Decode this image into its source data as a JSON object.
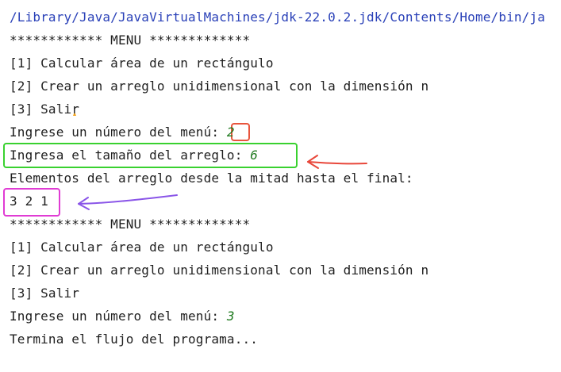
{
  "console": {
    "path": "/Library/Java/JavaVirtualMachines/jdk-22.0.2.jdk/Contents/Home/bin/ja",
    "menu_header_1": "************ MENU *************",
    "option1_1": "[1] Calcular área de un rectángulo",
    "option2_1": "[2] Crear un arreglo unidimensional con la dimensión n",
    "option3_1": "[3] Salir",
    "prompt_menu_1": "Ingrese un número del menú: ",
    "input_menu_1": "2",
    "prompt_size": "Ingresa el tamaño del arreglo: ",
    "input_size": "6",
    "elements_label": "Elementos del arreglo desde la mitad hasta el final:",
    "elements_output": "3 2 1",
    "menu_header_2": "************ MENU *************",
    "option1_2": "[1] Calcular área de un rectángulo",
    "option2_2": "[2] Crear un arreglo unidimensional con la dimensión n",
    "option3_2": "[3] Salir",
    "prompt_menu_2": "Ingrese un número del menú: ",
    "input_menu_2": "3",
    "end_message": "Termina el flujo del programa..."
  },
  "colors": {
    "path_text": "#2a41b8",
    "user_input": "#1f7a1f",
    "highlight_input_menu": "#e8553d",
    "highlight_size_line": "#39d12f",
    "highlight_elements": "#e03cd4",
    "arrow_red": "#e8473a",
    "arrow_purple": "#8a55e8"
  }
}
